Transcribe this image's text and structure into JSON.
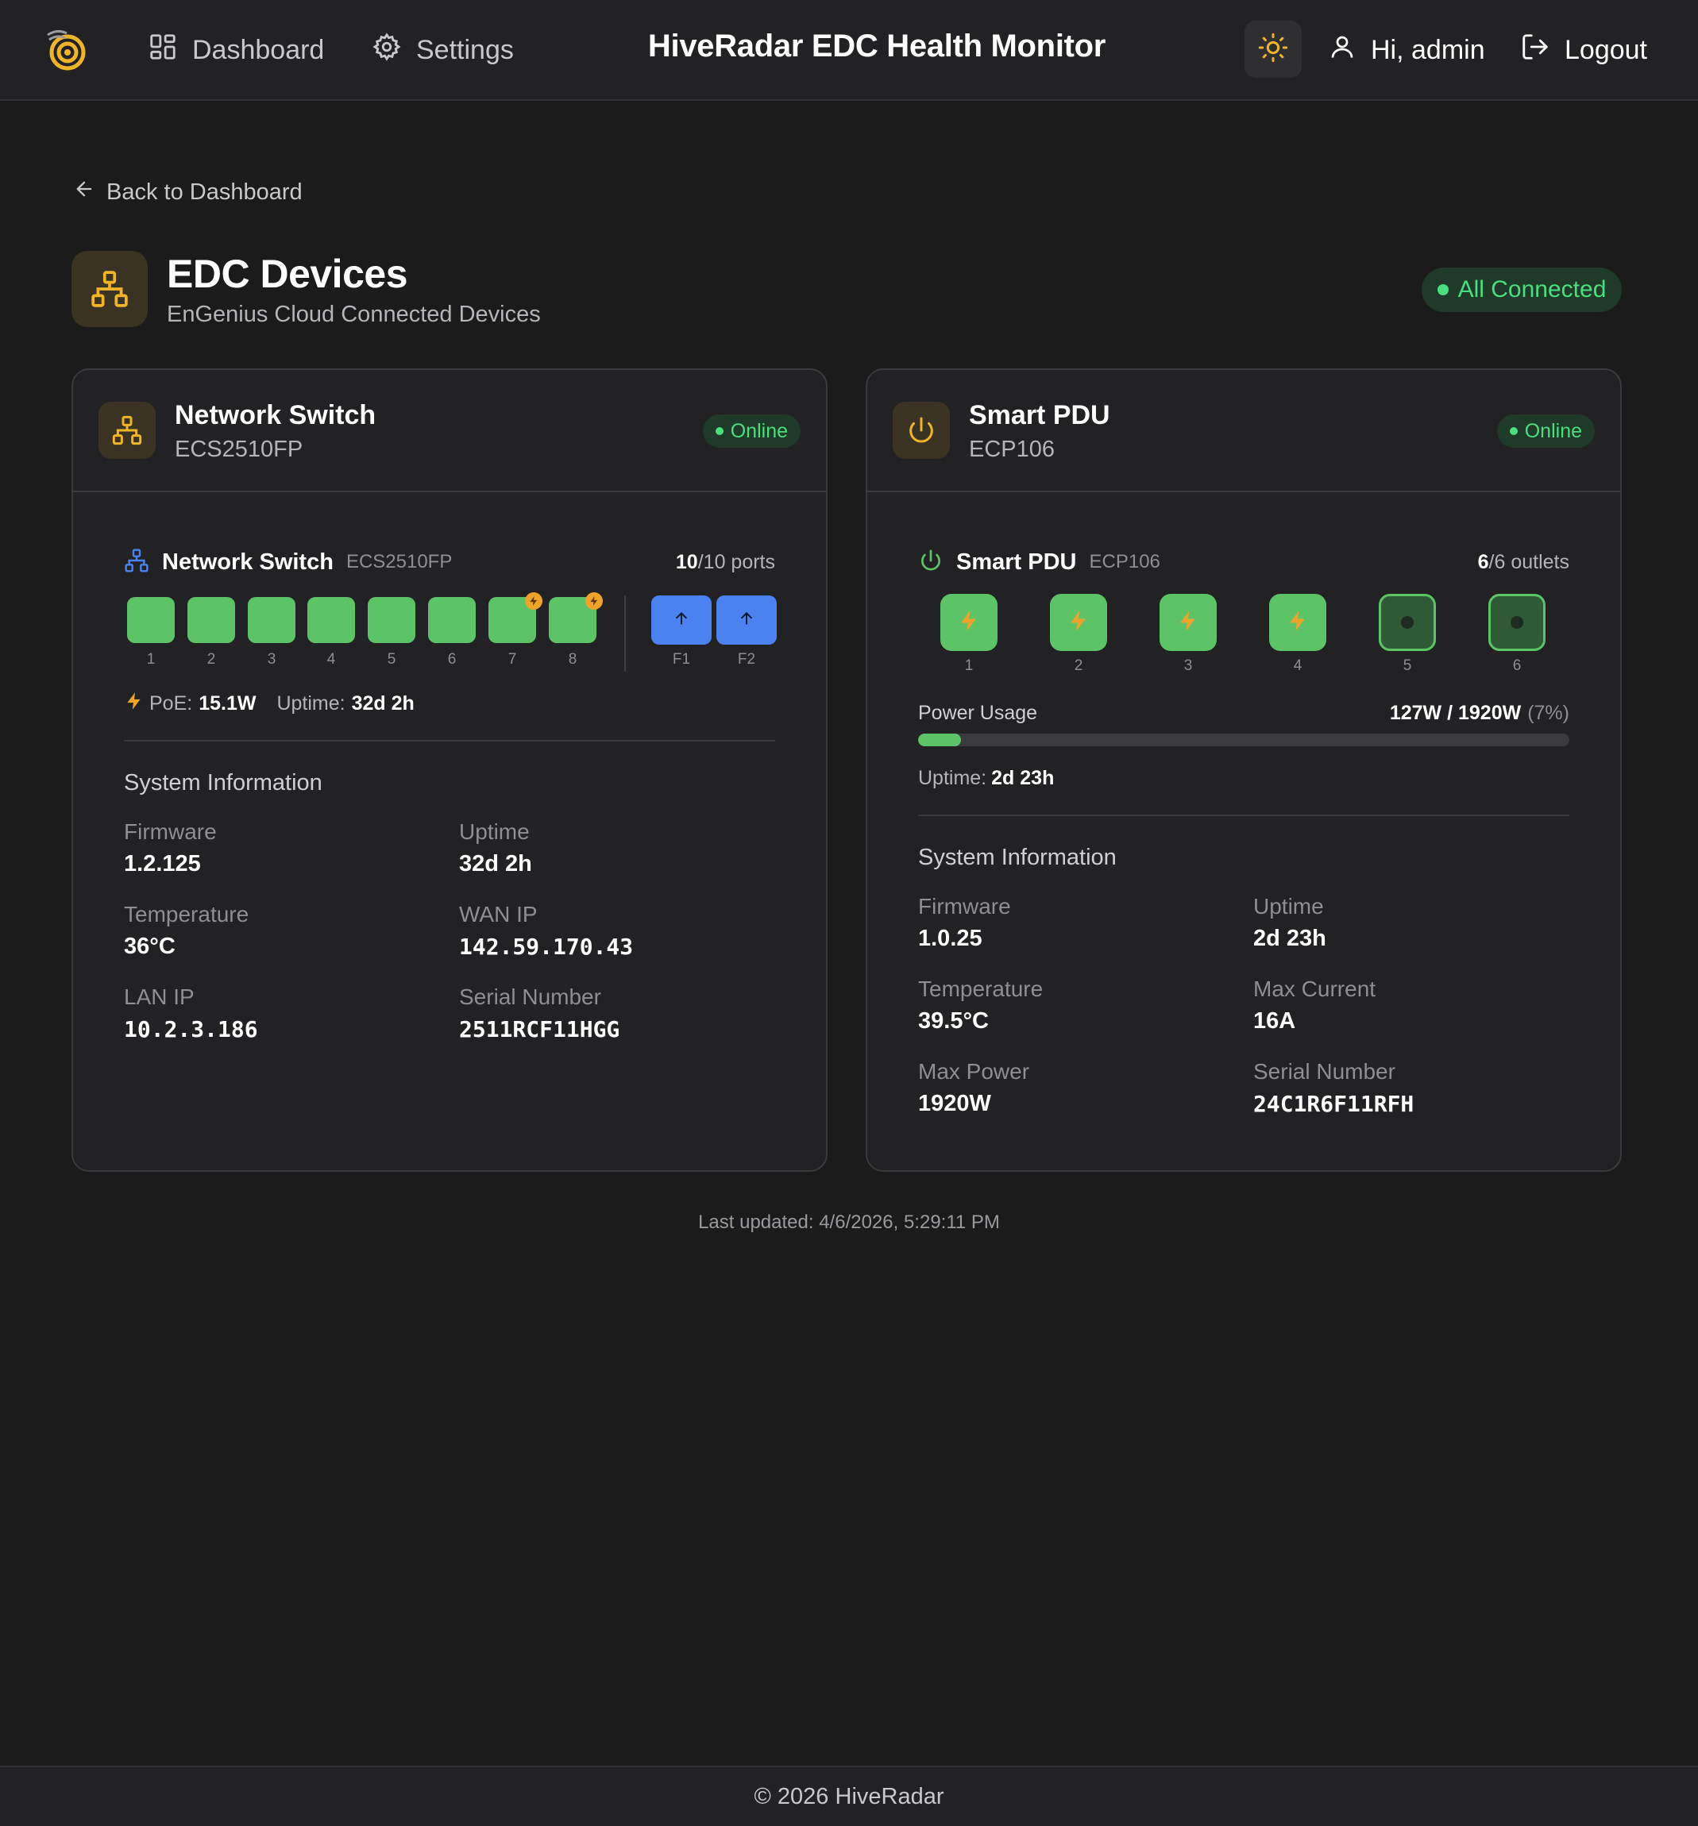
{
  "nav": {
    "logo_icon": "radar-logo-icon",
    "dashboard_label": "Dashboard",
    "settings_label": "Settings",
    "app_title": "HiveRadar EDC Health Monitor",
    "theme_icon": "sun-icon",
    "greeting": "Hi, admin",
    "logout_label": "Logout"
  },
  "page": {
    "back_label": "Back to Dashboard",
    "title": "EDC Devices",
    "subtitle": "EnGenius Cloud Connected Devices",
    "status": "All Connected"
  },
  "switch": {
    "name": "Network Switch",
    "model": "ECS2510FP",
    "status": "Online",
    "ports_active": "10",
    "ports_total": "/10 ports",
    "ports": [
      {
        "label": "1",
        "poe": false
      },
      {
        "label": "2",
        "poe": false
      },
      {
        "label": "3",
        "poe": false
      },
      {
        "label": "4",
        "poe": false
      },
      {
        "label": "5",
        "poe": false
      },
      {
        "label": "6",
        "poe": false
      },
      {
        "label": "7",
        "poe": true
      },
      {
        "label": "8",
        "poe": true
      }
    ],
    "sfp": [
      {
        "label": "F1"
      },
      {
        "label": "F2"
      }
    ],
    "poe_label": "PoE:",
    "poe_value": "15.1W",
    "uptime_label": "Uptime:",
    "uptime_value": "32d 2h",
    "system": {
      "title": "System Information",
      "firmware_label": "Firmware",
      "firmware": "1.2.125",
      "uptime_label": "Uptime",
      "uptime": "32d 2h",
      "temperature_label": "Temperature",
      "temperature": "36°C",
      "wan_label": "WAN IP",
      "wan_ip": "142.59.170.43",
      "lan_label": "LAN IP",
      "lan_ip": "10.2.3.186",
      "serial_label": "Serial Number",
      "serial": "2511RCF11HGG"
    }
  },
  "pdu": {
    "name": "Smart PDU",
    "model": "ECP106",
    "status": "Online",
    "outlets_active": "6",
    "outlets_total": "/6 outlets",
    "outlets": [
      {
        "label": "1",
        "state": "on"
      },
      {
        "label": "2",
        "state": "on"
      },
      {
        "label": "3",
        "state": "on"
      },
      {
        "label": "4",
        "state": "on"
      },
      {
        "label": "5",
        "state": "idle"
      },
      {
        "label": "6",
        "state": "idle"
      }
    ],
    "power_label": "Power Usage",
    "power_value": "127W / 1920W",
    "power_percent_text": "(7%)",
    "power_fraction": 0.066,
    "uptime_label": "Uptime:",
    "uptime_value": "2d 23h",
    "system": {
      "title": "System Information",
      "firmware_label": "Firmware",
      "firmware": "1.0.25",
      "uptime_label": "Uptime",
      "uptime": "2d 23h",
      "temperature_label": "Temperature",
      "temperature": "39.5°C",
      "max_current_label": "Max Current",
      "max_current": "16A",
      "max_power_label": "Max Power",
      "max_power": "1920W",
      "serial_label": "Serial Number",
      "serial": "24C1R6F11RFH"
    }
  },
  "last_updated": "Last updated: 4/6/2026, 5:29:11 PM",
  "footer": "© 2026 HiveRadar",
  "colors": {
    "accent": "#f0b429",
    "online": "#4ade80",
    "port_green": "#5cc466",
    "sfp_blue": "#4c82f0"
  }
}
